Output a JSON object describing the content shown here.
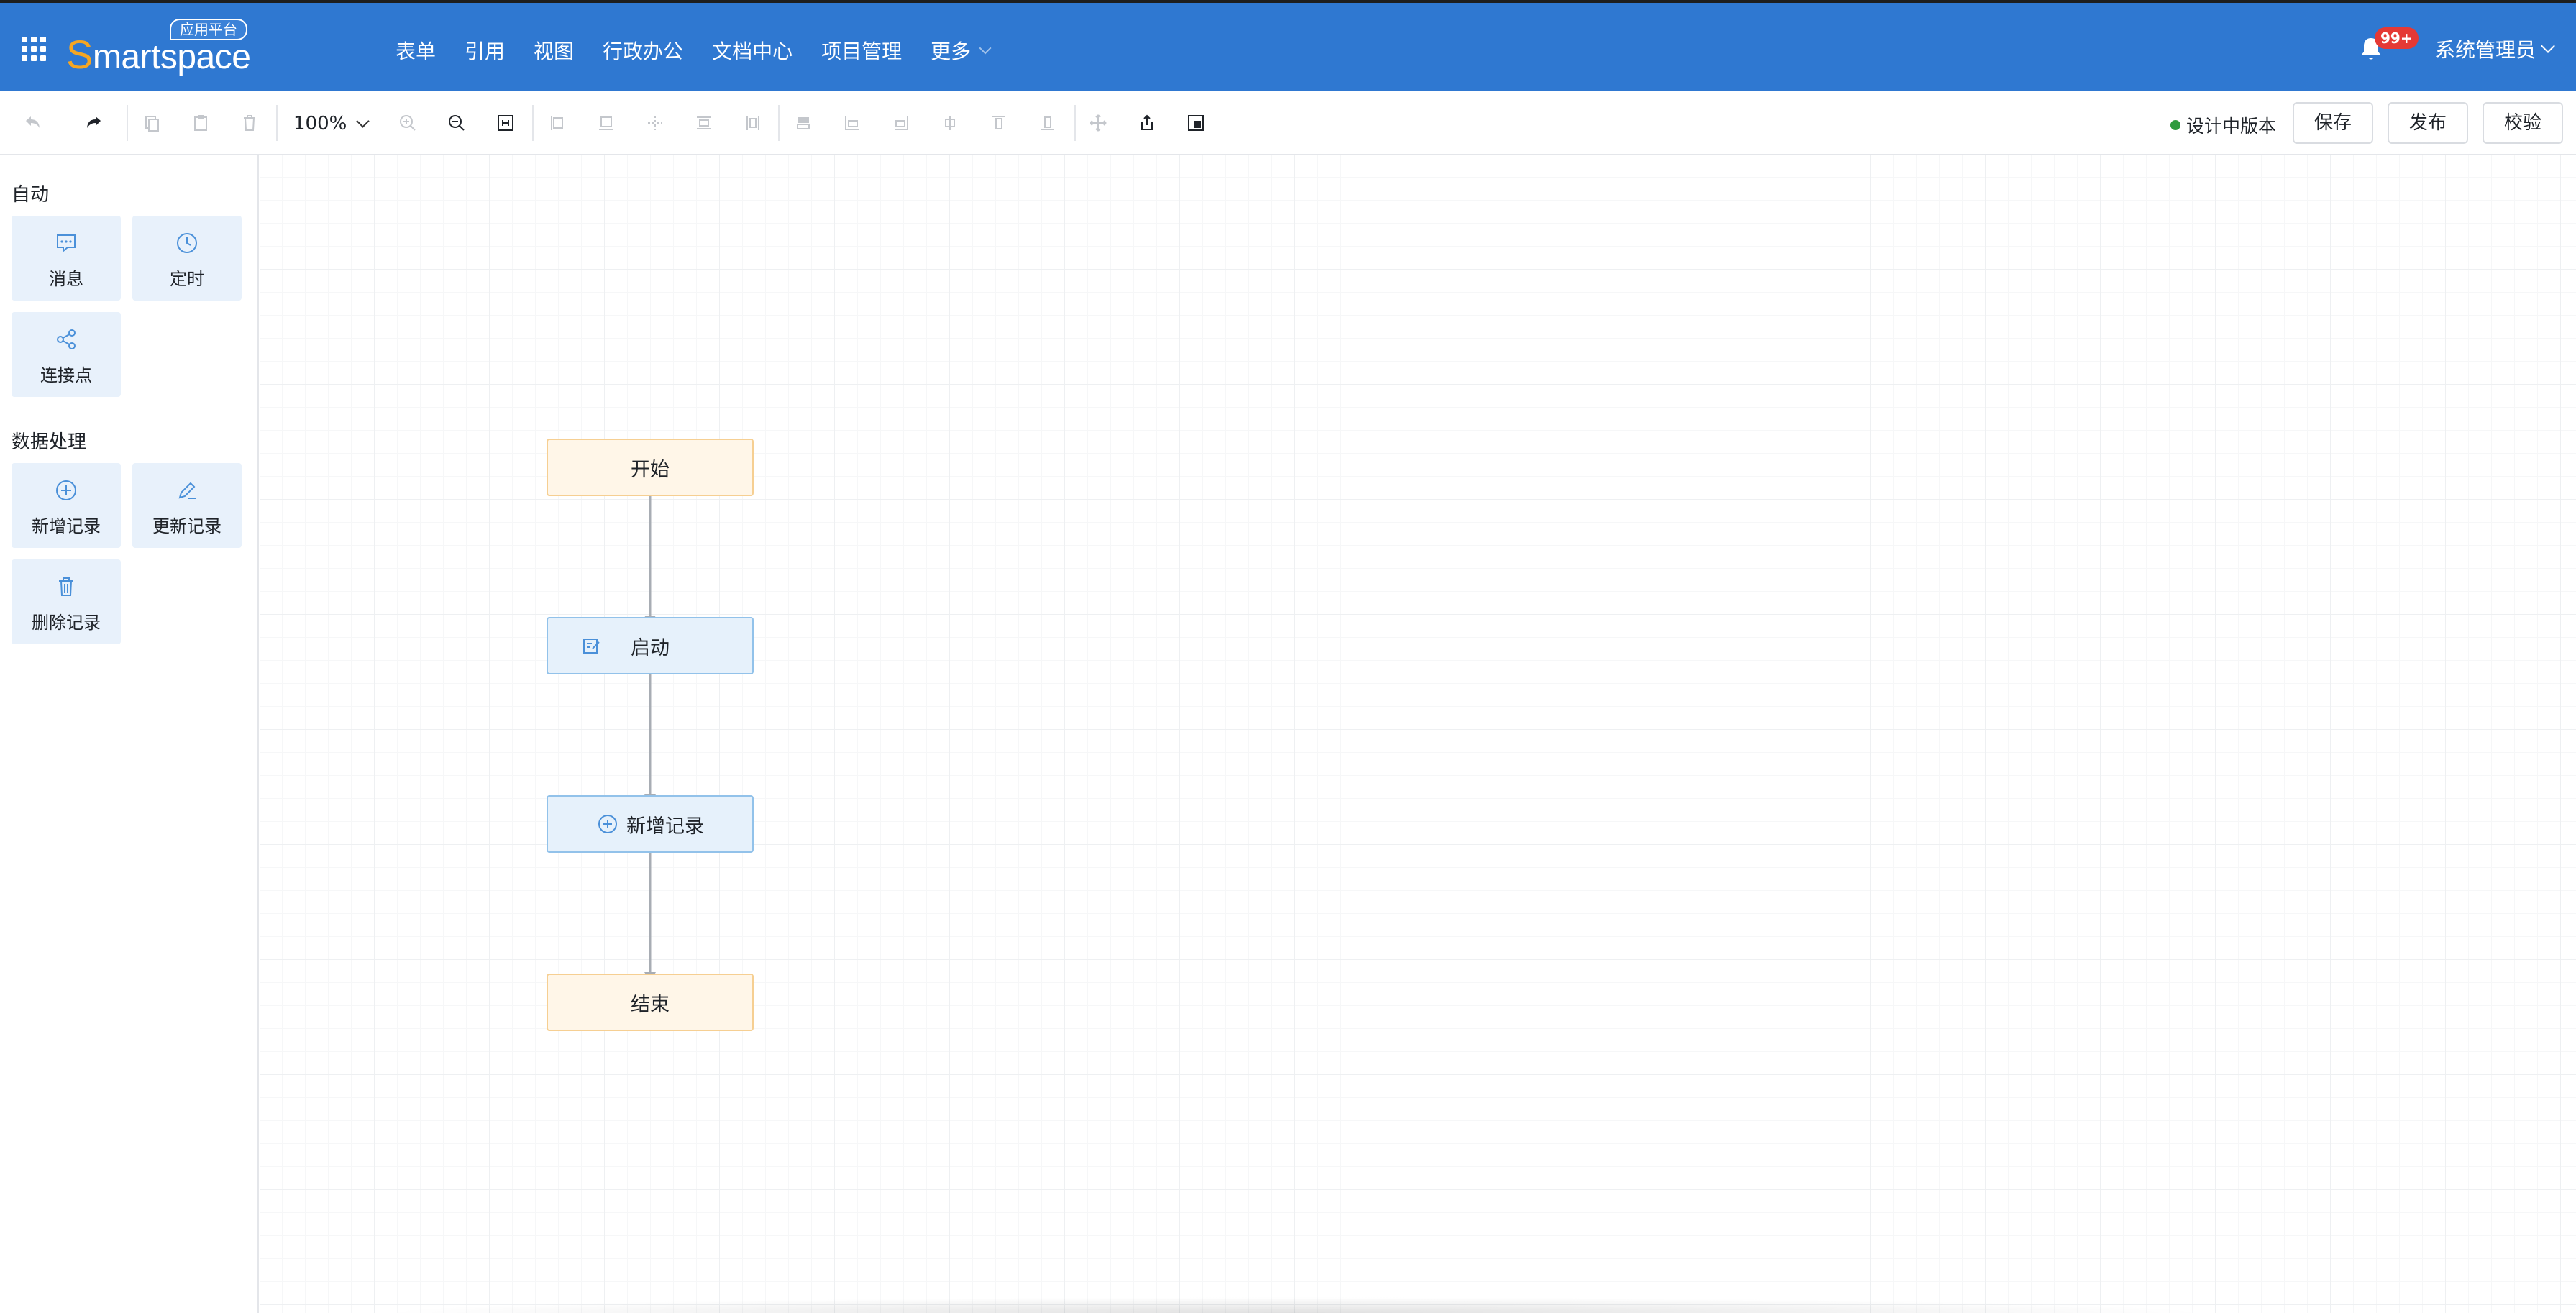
{
  "header": {
    "logo_text": "Smartspace",
    "logo_badge": "应用平台",
    "nav": [
      {
        "label": "表单"
      },
      {
        "label": "引用"
      },
      {
        "label": "视图"
      },
      {
        "label": "行政办公"
      },
      {
        "label": "文档中心"
      },
      {
        "label": "项目管理"
      },
      {
        "label": "更多"
      }
    ],
    "notification_count": "99+",
    "user_name": "系统管理员"
  },
  "toolbar": {
    "zoom": "100%",
    "status_text": "设计中版本",
    "status_color": "#2e9b3e",
    "save_label": "保存",
    "publish_label": "发布",
    "validate_label": "校验",
    "icons": [
      "undo-icon",
      "redo-icon",
      "copy-icon",
      "paste-icon",
      "delete-icon",
      "zoom-in-icon",
      "zoom-out-icon",
      "fit-icon",
      "align-left-icon",
      "align-bottom-icon",
      "center-icon",
      "align-top-icon",
      "distribute-icon",
      "layer-icon",
      "align-left-edge-icon",
      "align-right-edge-icon",
      "align-h-center-icon",
      "align-top-edge-icon",
      "align-bottom-edge-icon",
      "move-icon",
      "export-icon",
      "minimap-icon"
    ]
  },
  "sidebar": {
    "sections": [
      {
        "title": "自动",
        "items": [
          {
            "label": "消息",
            "icon": "message-icon"
          },
          {
            "label": "定时",
            "icon": "clock-icon"
          },
          {
            "label": "连接点",
            "icon": "share-icon"
          }
        ]
      },
      {
        "title": "数据处理",
        "items": [
          {
            "label": "新增记录",
            "icon": "plus-circle-icon"
          },
          {
            "label": "更新记录",
            "icon": "edit-icon"
          },
          {
            "label": "删除记录",
            "icon": "trash-icon"
          }
        ]
      }
    ]
  },
  "flow": {
    "nodes": [
      {
        "label": "开始",
        "type": "terminal"
      },
      {
        "label": "启动",
        "type": "action",
        "icon": "form-edit-icon"
      },
      {
        "label": "新增记录",
        "type": "action",
        "icon": "plus-circle-icon"
      },
      {
        "label": "结束",
        "type": "terminal"
      }
    ]
  },
  "colors": {
    "header_bg": "#2f78d1",
    "terminal_bg": "#fff6e8",
    "action_bg": "#e6f1fb",
    "accent": "#4a90d9"
  }
}
